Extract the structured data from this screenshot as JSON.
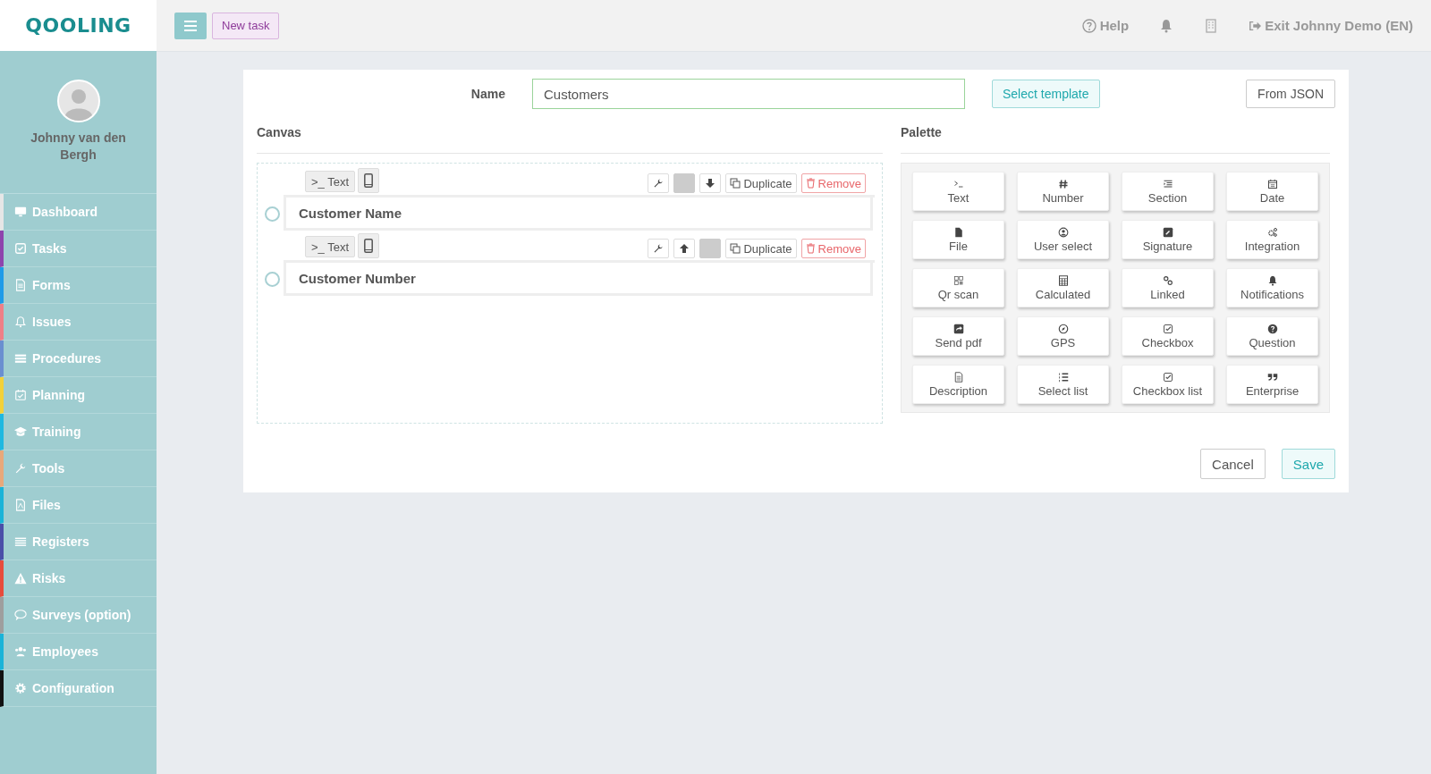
{
  "logo": "QOOLING",
  "user": {
    "name": "Johnny van den Bergh"
  },
  "sidebar": {
    "items": [
      {
        "label": "Dashboard",
        "color": "#e6e6e6"
      },
      {
        "label": "Tasks",
        "color": "#8e44ad"
      },
      {
        "label": "Forms",
        "color": "#1e9be8"
      },
      {
        "label": "Issues",
        "color": "#ee7f87"
      },
      {
        "label": "Procedures",
        "color": "#6a8fd0"
      },
      {
        "label": "Planning",
        "color": "#f2d13a"
      },
      {
        "label": "Training",
        "color": "#1fb8e0"
      },
      {
        "label": "Tools",
        "color": "#e8a87a"
      },
      {
        "label": "Files",
        "color": "#1ab3d8"
      },
      {
        "label": "Registers",
        "color": "#4a4fa8"
      },
      {
        "label": "Risks",
        "color": "#e74c3c"
      },
      {
        "label": "Surveys (option)",
        "color": "#9e9e9e"
      },
      {
        "label": "Employees",
        "color": "#1ab3d8"
      },
      {
        "label": "Configuration",
        "color": "#111111"
      }
    ]
  },
  "topbar": {
    "new_task": "New task",
    "help": "Help",
    "exit": "Exit Johnny Demo (EN)"
  },
  "form": {
    "name_label": "Name",
    "name_value": "Customers",
    "select_template": "Select template",
    "from_json": "From JSON"
  },
  "canvas": {
    "title": "Canvas",
    "fields": [
      {
        "tag": ">_ Text",
        "label": "Customer Name",
        "selected": false,
        "can_move_up": false,
        "can_move_down": true,
        "duplicate": "Duplicate",
        "remove": "Remove"
      },
      {
        "tag": ">_ Text",
        "label": "Customer Number",
        "selected": false,
        "can_move_up": true,
        "can_move_down": false,
        "duplicate": "Duplicate",
        "remove": "Remove"
      }
    ]
  },
  "palette": {
    "title": "Palette",
    "items": [
      "Text",
      "Number",
      "Section",
      "Date",
      "File",
      "User select",
      "Signature",
      "Integration",
      "Qr scan",
      "Calculated",
      "Linked",
      "Notifications",
      "Send pdf",
      "GPS",
      "Checkbox",
      "Question",
      "Description",
      "Select list",
      "Checkbox list",
      "Enterprise"
    ]
  },
  "buttons": {
    "cancel": "Cancel",
    "save": "Save"
  }
}
